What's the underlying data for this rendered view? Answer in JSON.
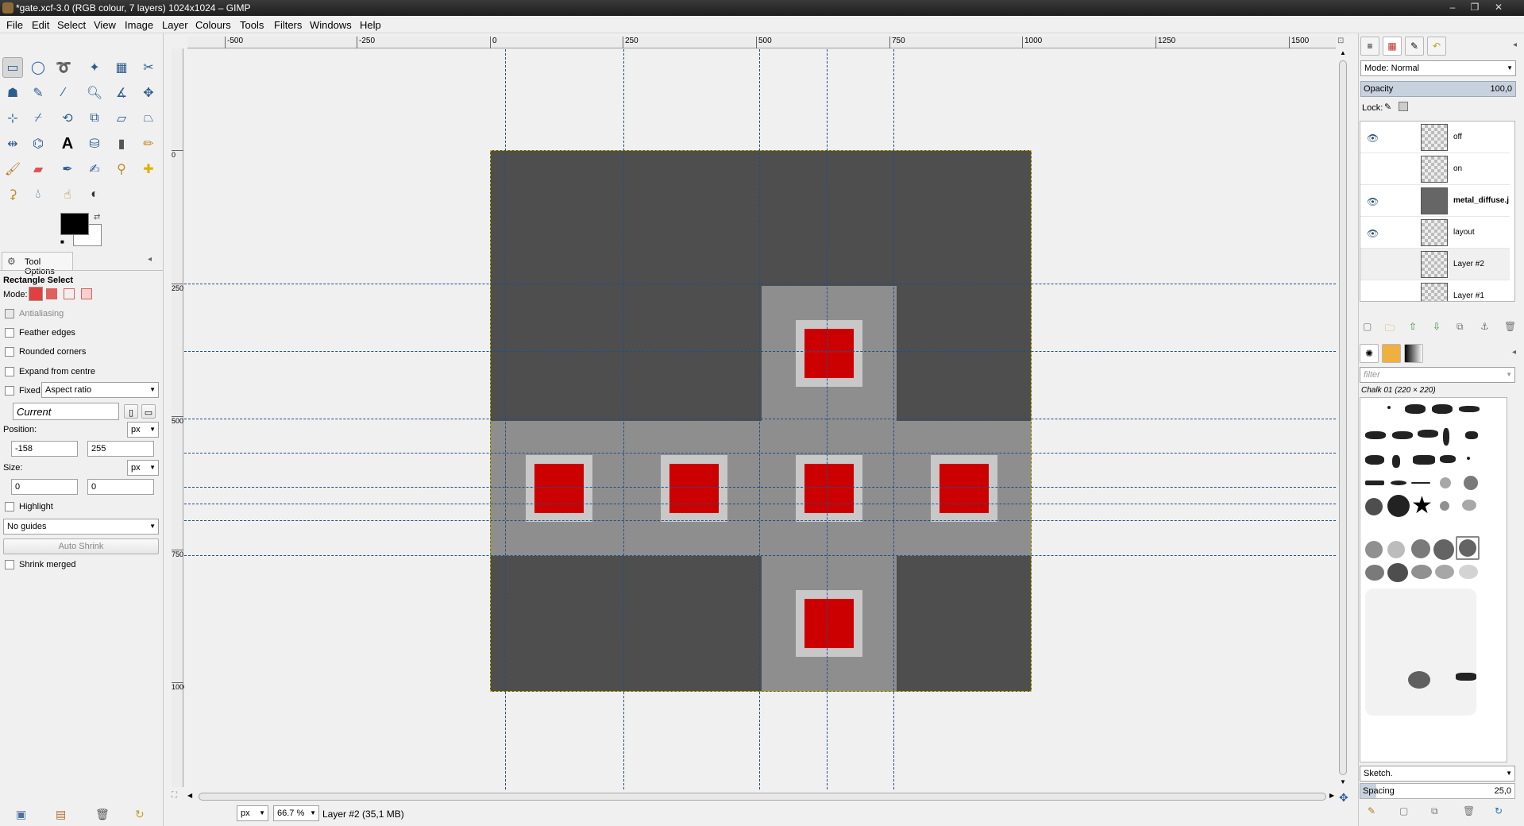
{
  "window": {
    "title": "*gate.xcf-3.0 (RGB colour, 7 layers) 1024x1024 – GIMP",
    "controls": [
      "–",
      "❐",
      "✕"
    ]
  },
  "menubar": [
    "File",
    "Edit",
    "Select",
    "View",
    "Image",
    "Layer",
    "Colours",
    "Tools",
    "Filters",
    "Windows",
    "Help"
  ],
  "toolbox": {
    "tools": [
      "rect-select-icon",
      "ellipse-select-icon",
      "free-select-icon",
      "fuzzy-select-icon",
      "select-by-color-icon",
      "scissors-icon",
      "foreground-select-icon",
      "paths-icon",
      "color-picker-icon",
      "zoom-icon",
      "measure-icon",
      "move-icon",
      "align-icon",
      "crop-icon",
      "rotate-icon",
      "scale-icon",
      "shear-icon",
      "perspective-icon",
      "flip-icon",
      "cage-icon",
      "text-icon",
      "bucket-fill-icon",
      "blend-icon",
      "pencil-icon",
      "paintbrush-icon",
      "eraser-icon",
      "airbrush-icon",
      "ink-icon",
      "clone-icon",
      "heal-icon",
      "perspective-clone-icon",
      "blur-icon",
      "smudge-icon",
      "dodge-burn-icon"
    ],
    "fg_color": "#000000",
    "bg_color": "#ffffff"
  },
  "tool_options": {
    "tab_label": "Tool Options",
    "title": "Rectangle Select",
    "mode_label": "Mode:",
    "antialiasing": "Antialiasing",
    "feather": "Feather edges",
    "rounded": "Rounded corners",
    "expand": "Expand from centre",
    "fixed": "Fixed:",
    "fixed_option": "Aspect ratio",
    "current": "Current",
    "position_label": "Position:",
    "position_unit": "px",
    "pos_x": "-158",
    "pos_y": "255",
    "size_label": "Size:",
    "size_unit": "px",
    "size_w": "0",
    "size_h": "0",
    "highlight": "Highlight",
    "guides": "No guides",
    "auto_shrink": "Auto Shrink",
    "shrink_merged": "Shrink merged"
  },
  "rulers": {
    "h_labels": [
      "-500",
      "-250",
      "0",
      "250",
      "500",
      "750",
      "1000",
      "1250",
      "1500"
    ],
    "v_labels": [
      "0",
      "250",
      "500",
      "750",
      "1000"
    ]
  },
  "statusbar": {
    "unit": "px",
    "zoom": "66.7 %",
    "message": "Layer #2 (35,1 MB)"
  },
  "layers": {
    "mode_label": "Mode: Normal",
    "opacity_label": "Opacity",
    "opacity_value": "100,0",
    "lock_label": "Lock:",
    "items": [
      {
        "name": "off",
        "visible": true
      },
      {
        "name": "on",
        "visible": false
      },
      {
        "name": "metal_diffuse.j",
        "visible": true
      },
      {
        "name": "layout",
        "visible": true
      },
      {
        "name": "Layer #2",
        "visible": false
      },
      {
        "name": "Layer #1",
        "visible": false
      }
    ]
  },
  "brushes": {
    "filter_placeholder": "filter",
    "current_brush": "Chalk 01 (220 × 220)",
    "tag": "Sketch.",
    "spacing_label": "Spacing",
    "spacing_value": "25,0"
  }
}
